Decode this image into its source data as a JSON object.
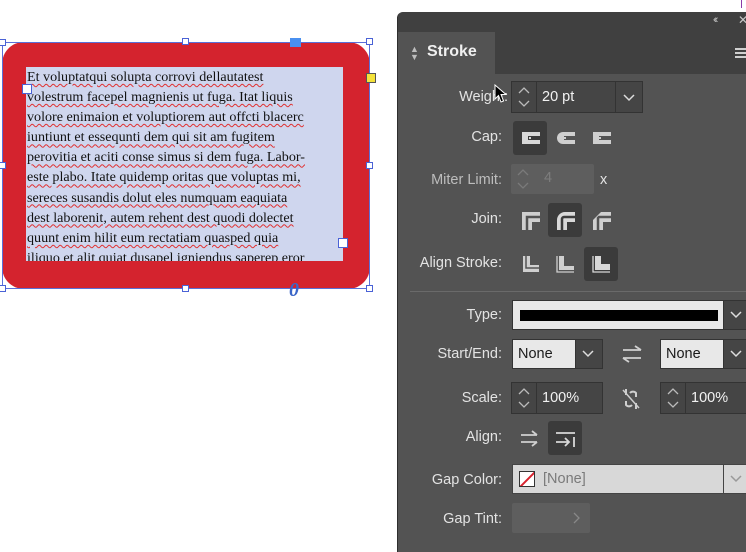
{
  "document": {
    "text_lines": [
      "Et voluptatqui solupta corrovi dellautatest",
      "volestrum facepel magnienis ut fuga. Itat liquis",
      "volore enimaion et voluptiorem aut offcti blacerc",
      "iuntiunt et essequnti dem qui sit am fugitem",
      "perovitia et aciti conse simus si dem fuga. Labor-",
      "este plabo. Itate quidemp oritas que voluptas mi,",
      "sereces susandis dolut eles numquam eaquiata",
      "dest laborenit, autem rehent dest quodi dolectet",
      "quunt enim hilit eum rectatiam quasped quia",
      "iliquo et alit quiat dusapel igniendus saperep eror"
    ],
    "frame_color": "#d4232e",
    "text_bg_color": "#cfd6ee"
  },
  "panel": {
    "title": "Stroke",
    "weight": {
      "label": "Weight:",
      "value": "20 pt"
    },
    "cap": {
      "label": "Cap:",
      "options": [
        "butt-cap-icon",
        "round-cap-icon",
        "projecting-cap-icon"
      ],
      "selected": 0
    },
    "miter": {
      "label": "Miter Limit:",
      "value": "4",
      "suffix": "x"
    },
    "join": {
      "label": "Join:",
      "options": [
        "miter-join-icon",
        "round-join-icon",
        "bevel-join-icon"
      ],
      "selected": 1
    },
    "align_stroke": {
      "label": "Align Stroke:",
      "options": [
        "align-center-icon",
        "align-inside-icon",
        "align-outside-icon"
      ],
      "selected": 2
    },
    "type": {
      "label": "Type:"
    },
    "start_end": {
      "label": "Start/End:",
      "start": "None",
      "end": "None"
    },
    "scale": {
      "label": "Scale:",
      "start": "100%",
      "end": "100%"
    },
    "align": {
      "label": "Align:",
      "selected": 1
    },
    "gap_color": {
      "label": "Gap Color:",
      "value": "[None]"
    },
    "gap_tint": {
      "label": "Gap Tint:"
    }
  }
}
